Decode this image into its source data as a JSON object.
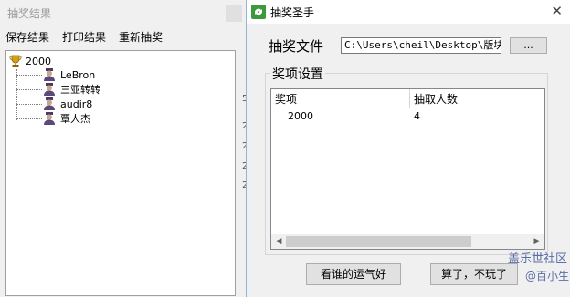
{
  "bg_window": {
    "title": "抽奖结果",
    "menu": [
      "保存结果",
      "打印结果",
      "重新抽奖"
    ],
    "tree": {
      "root": "2000",
      "items": [
        "LeBron",
        "三亚转转",
        "audir8",
        "覃人杰"
      ]
    },
    "stray_chars": [
      "5",
      "2",
      "2",
      "2",
      "2"
    ]
  },
  "dialog": {
    "title": "抽奖圣手",
    "close_glyph": "✕",
    "file_label": "抽奖文件",
    "file_path": "C:\\Users\\cheil\\Desktop\\版块活",
    "browse_label": "...",
    "group_label": "奖项设置",
    "columns": [
      "奖项",
      "抽取人数"
    ],
    "rows": [
      {
        "prize": "2000",
        "count": "4"
      }
    ],
    "btn_lucky": "看谁的运气好",
    "btn_quit": "算了，不玩了"
  },
  "watermark": {
    "line1": "盖乐世社区",
    "line2": "@百小生"
  },
  "colors": {
    "accent": "#3c9a3c",
    "title_border": "#8fb6d8",
    "watermark": "#5a6ea6"
  }
}
